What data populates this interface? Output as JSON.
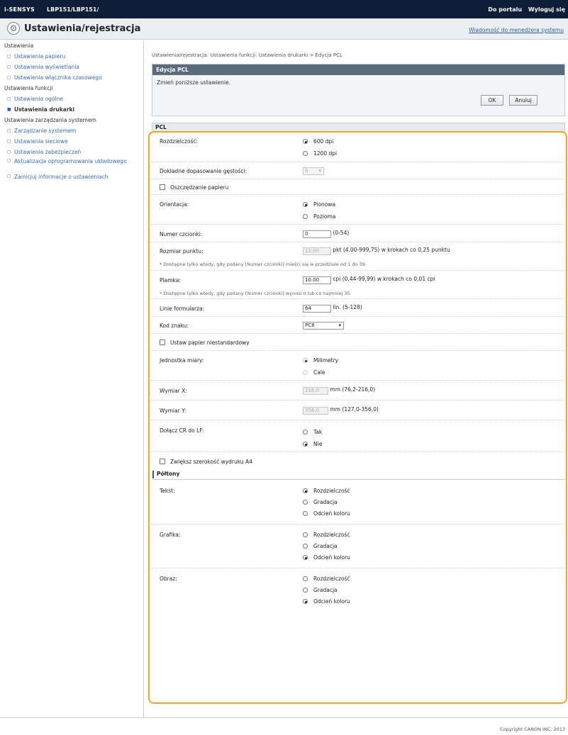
{
  "topbar": {
    "brand": "i-SENSYS",
    "model": "LBP151/LBP151/",
    "portal_link": "Do portalu",
    "logout_link": "Wyloguj się"
  },
  "titlebar": {
    "title": "Ustawienia/rejestracja",
    "admin_message_link": "Wiadomość do menedżera systemu"
  },
  "sidebar": {
    "groups": [
      {
        "label": "Ustawienia",
        "items": [
          {
            "label": "Ustawienia papieru"
          },
          {
            "label": "Ustawienia wyświetlania"
          },
          {
            "label": "Ustawienia włącznika czasowego"
          }
        ]
      },
      {
        "label": "Ustawienia funkcji",
        "items": [
          {
            "label": "Ustawienia ogólne"
          },
          {
            "label": "Ustawienia drukarki"
          }
        ]
      },
      {
        "label": "Ustawienia zarządzania systemem",
        "items": [
          {
            "label": "Zarządzanie systemem"
          },
          {
            "label": "Ustawienia sieciowe"
          },
          {
            "label": "Ustawienia zabezpieczeń"
          },
          {
            "label": "Aktualizacja oprogramowania układowego"
          },
          {
            "label": "Zainicjuj informacje o ustawieniach"
          }
        ]
      }
    ]
  },
  "main": {
    "breadcrumb": "Ustawienia/rejestracja: Ustawienia funkcji: Ustawienia drukarki > Edycja PCL",
    "panel_title": "Edycja PCL",
    "panel_text": "Zmień poniższe ustawienie.",
    "ok_label": "OK",
    "cancel_label": "Anuluj",
    "section_title": "PCL"
  },
  "form": {
    "resolution_label": "Rozdzielczość:",
    "resolution_opt1": "600 dpi",
    "resolution_opt2": "1200 dpi",
    "density_label": "Dokładne dopasowanie gęstości:",
    "density_value": "0",
    "paper_save_label": "Oszczędzanie papieru",
    "orientation_label": "Orientacja:",
    "orientation_opt1": "Pionowa",
    "orientation_opt2": "Pozioma",
    "font_number_label": "Numer czcionki:",
    "font_number_value": "0",
    "font_number_range": "(0-54)",
    "point_size_label": "Rozmiar punktu:",
    "point_size_value": "12.00",
    "point_size_range": "pkt (4,00-999,75) w krokach co 0,25 punktu",
    "note1": "* Dostępne tylko wtedy, gdy podany [Numer czcionki] mieści się w przedziale od 1 do 39.",
    "pitch_label": "Plamka:",
    "pitch_value": "10.00",
    "pitch_range": "cpi (0,44-99,99) w krokach co 0,01 cpi",
    "note2": "* Dostępne tylko wtedy, gdy podany [Numer czcionki] wynosi 0 lub co najmniej 35.",
    "form_lines_label": "Linie formularza:",
    "form_lines_value": "64",
    "form_lines_range": "lin. (5-128)",
    "symbol_set_label": "Kod znaku:",
    "symbol_set_value": "PC8",
    "custom_paper_label": "Ustaw papier niestandardowy",
    "unit_label": "Jednostka miary:",
    "unit_opt1": "Milimetry",
    "unit_opt2": "Cale",
    "x_label": "Wymiar X:",
    "x_value": "216.0",
    "x_range": "mm (76,2-216,0)",
    "y_label": "Wymiar Y:",
    "y_value": "356.0",
    "y_range": "mm (127,0-356,0)",
    "append_cr_label": "Dołącz CR do LF:",
    "append_cr_opt1": "Tak",
    "append_cr_opt2": "Nie",
    "a4_wider_label": "Zwiększ szerokość wydruku A4",
    "halftones_title": "Półtony",
    "text_label": "Tekst:",
    "text_opt1": "Rozdzielczość",
    "text_opt2": "Gradacja",
    "text_opt3": "Odcień koloru",
    "graphics_label": "Grafika:",
    "graphics_opt1": "Rozdzielczość",
    "graphics_opt2": "Gradacja",
    "graphics_opt3": "Odcień koloru",
    "image_label": "Obraz:",
    "image_opt1": "Rozdzielczość",
    "image_opt2": "Gradacja",
    "image_opt3": "Odcień koloru"
  },
  "footer": {
    "copyright": "Copyright CANON INC. 2013"
  },
  "icons": {
    "settings": "gear-icon",
    "top": "page-top-icon"
  },
  "colors": {
    "topbar_bg": "#0f1e38",
    "panel_header": "#5c6b7b",
    "highlight_border": "#f5a623",
    "link": "#3a6cb5"
  }
}
